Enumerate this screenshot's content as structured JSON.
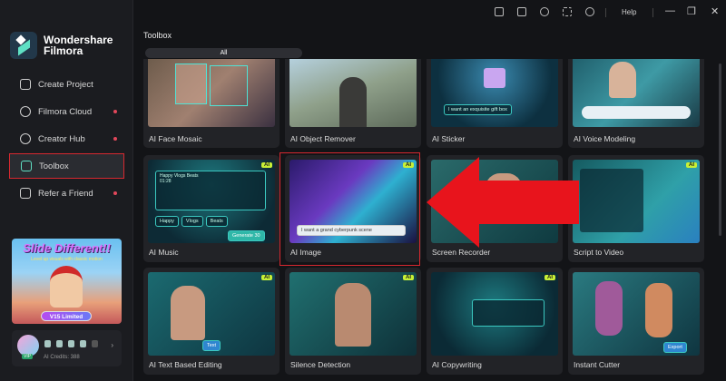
{
  "app": {
    "brand_line1": "Wondershare",
    "brand_line2": "Filmora"
  },
  "titlebar": {
    "help": "Help",
    "minimize": "—",
    "restore": "❐",
    "close": "✕"
  },
  "sidebar": {
    "items": [
      {
        "label": "Create Project",
        "dot": false
      },
      {
        "label": "Filmora Cloud",
        "dot": true
      },
      {
        "label": "Creator Hub",
        "dot": true
      },
      {
        "label": "Toolbox",
        "dot": false,
        "active": true
      },
      {
        "label": "Refer a Friend",
        "dot": true
      }
    ],
    "promo": {
      "title": "Slide Different!!",
      "subtitle": "Level up visuals with classic motion",
      "badge": "V15 Limited"
    },
    "user": {
      "vip": "VIP",
      "credits": "AI Credits: 388"
    }
  },
  "main": {
    "title": "Toolbox",
    "tabs": [
      {
        "label": "All"
      }
    ],
    "tools": [
      {
        "label": "AI Face Mosaic",
        "ai": false
      },
      {
        "label": "AI Object Remover",
        "ai": false
      },
      {
        "label": "AI Sticker",
        "ai": false,
        "prompt": "I want an exquisite gift box"
      },
      {
        "label": "AI Voice Modeling",
        "ai": false
      },
      {
        "label": "AI Music",
        "ai": true,
        "track": "Happy Vlogs Beats",
        "time": "01:28",
        "tags": [
          "Happy",
          "Vlogs",
          "Beats"
        ],
        "button": "Generate 30"
      },
      {
        "label": "AI Image",
        "ai": true,
        "prompt": "I want a grand cyberpunk scene"
      },
      {
        "label": "Screen Recorder",
        "ai": false
      },
      {
        "label": "Script to Video",
        "ai": true
      },
      {
        "label": "AI Text Based Editing",
        "ai": true,
        "button": "Text"
      },
      {
        "label": "Silence Detection",
        "ai": true
      },
      {
        "label": "AI Copywriting",
        "ai": true
      },
      {
        "label": "Instant Cutter",
        "ai": false,
        "button": "Export"
      }
    ]
  },
  "ai_badge": "AI",
  "colors": {
    "accent": "#5fe0c4",
    "highlight": "#d7282f",
    "ai_badge": "#c8f036"
  }
}
